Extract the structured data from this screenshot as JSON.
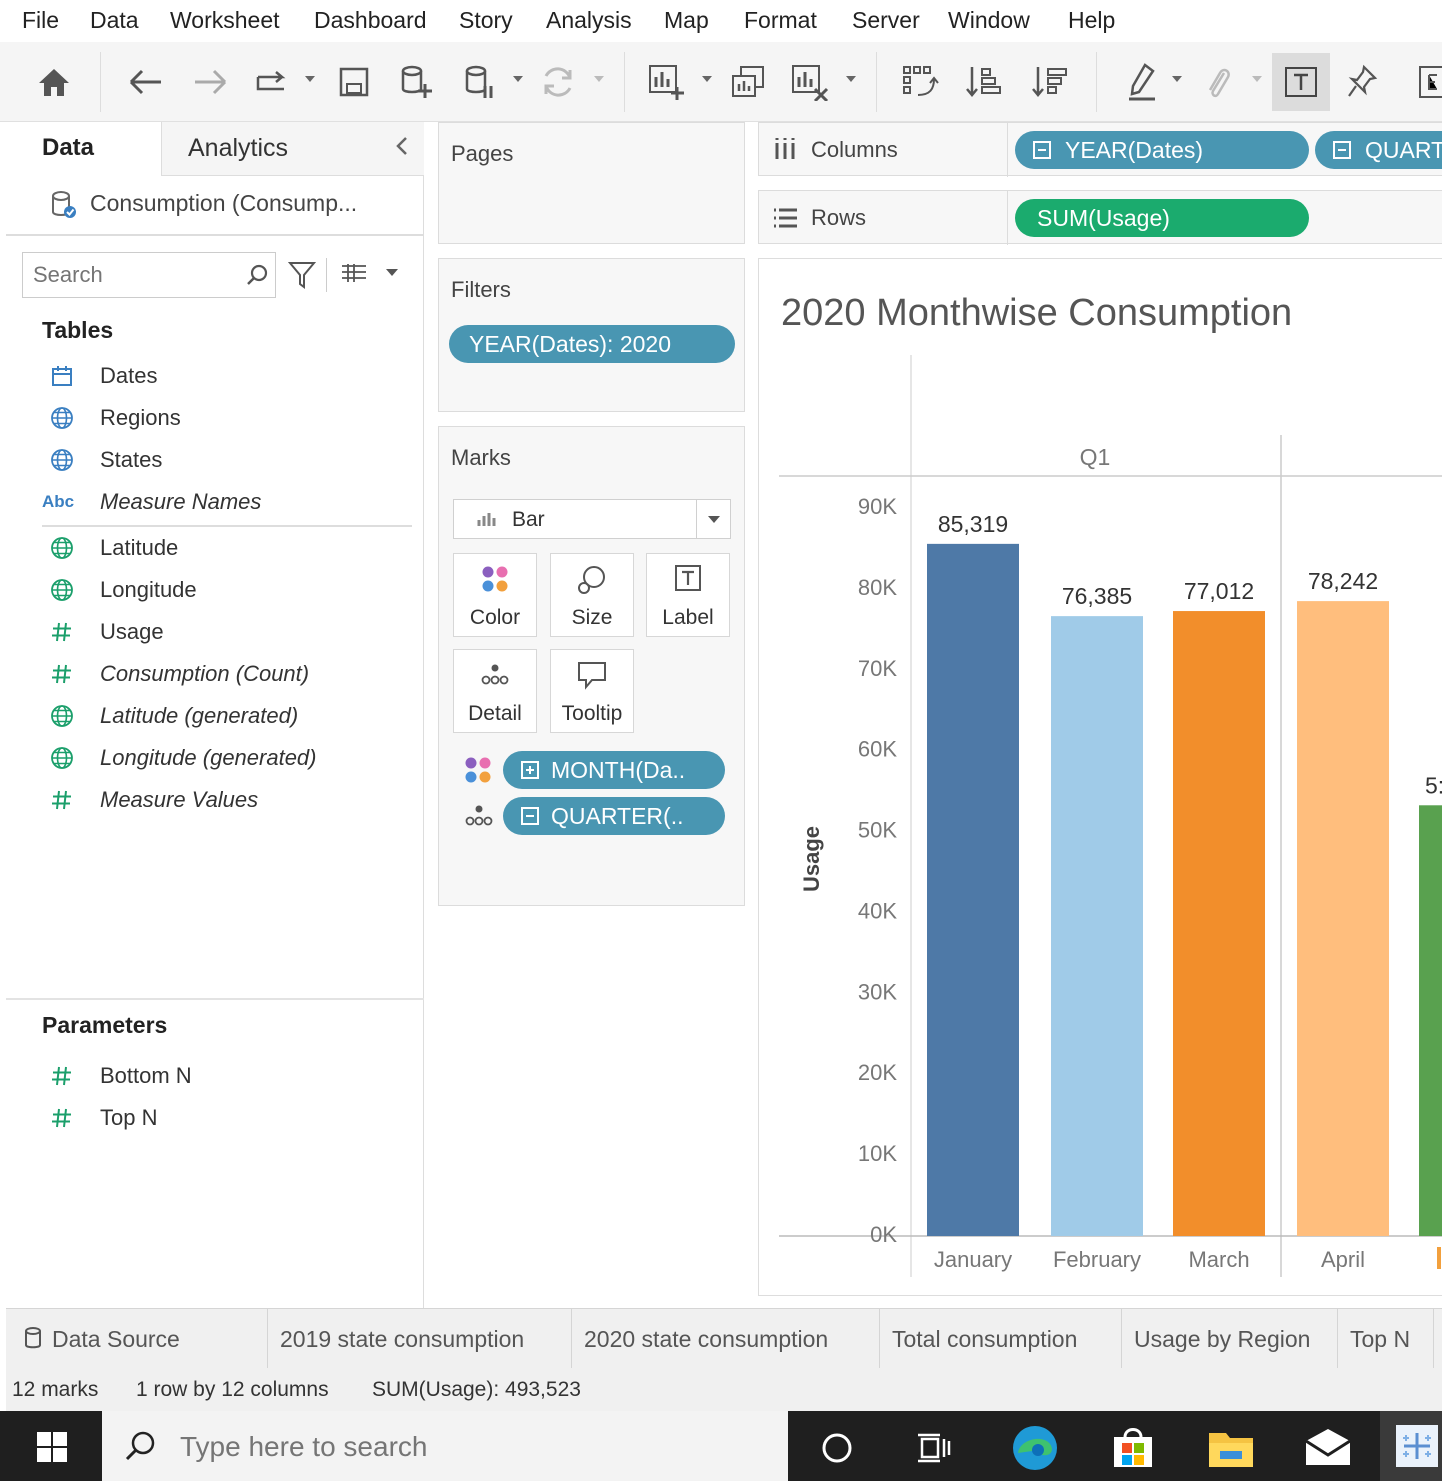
{
  "menu": [
    "File",
    "Data",
    "Worksheet",
    "Dashboard",
    "Story",
    "Analysis",
    "Map",
    "Format",
    "Server",
    "Window",
    "Help"
  ],
  "data_pane": {
    "tab_data": "Data",
    "tab_analytics": "Analytics",
    "datasource": "Consumption (Consump...",
    "search_placeholder": "Search",
    "tables_header": "Tables",
    "fields": [
      {
        "label": "Dates",
        "icon": "calendar-icon",
        "italic": false
      },
      {
        "label": "Regions",
        "icon": "globe-icon",
        "italic": false
      },
      {
        "label": "States",
        "icon": "globe-icon",
        "italic": false
      },
      {
        "label": "Measure Names",
        "icon": "abc-icon",
        "italic": true
      },
      {
        "label": "Latitude",
        "icon": "globe-icon",
        "italic": false
      },
      {
        "label": "Longitude",
        "icon": "globe-icon",
        "italic": false
      },
      {
        "label": "Usage",
        "icon": "hash-icon",
        "italic": false
      },
      {
        "label": "Consumption (Count)",
        "icon": "hash-icon",
        "italic": true
      },
      {
        "label": "Latitude (generated)",
        "icon": "globe-icon",
        "italic": true
      },
      {
        "label": "Longitude (generated)",
        "icon": "globe-icon",
        "italic": true
      },
      {
        "label": "Measure Values",
        "icon": "hash-icon",
        "italic": true
      }
    ],
    "abc_text": "Abc",
    "parameters_header": "Parameters",
    "parameters": [
      {
        "label": "Bottom N",
        "icon": "hash-icon"
      },
      {
        "label": "Top N",
        "icon": "hash-icon"
      }
    ]
  },
  "pages": {
    "title": "Pages"
  },
  "filters": {
    "title": "Filters",
    "pill": "YEAR(Dates): 2020"
  },
  "marks": {
    "title": "Marks",
    "type": "Bar",
    "buttons": [
      "Color",
      "Size",
      "Label",
      "Detail",
      "Tooltip"
    ],
    "pills": [
      "MONTH(Da..",
      "QUARTER(.."
    ]
  },
  "shelves": {
    "columns_label": "Columns",
    "rows_label": "Rows",
    "columns_pills": [
      "YEAR(Dates)",
      "QUART"
    ],
    "rows_pills": [
      "SUM(Usage)"
    ]
  },
  "chart_data": {
    "type": "bar",
    "title": "2020 Monthwise Consumption",
    "ylabel": "Usage",
    "header": "Q1",
    "categories": [
      "January",
      "February",
      "March",
      "April"
    ],
    "values": [
      85319,
      76385,
      77012,
      78242
    ],
    "value_labels": [
      "85,319",
      "76,385",
      "77,012",
      "78,242"
    ],
    "colors": [
      "#4e79a7",
      "#a0cbe8",
      "#f28e2b",
      "#ffbe7d"
    ],
    "yticks": [
      "90K",
      "80K",
      "70K",
      "60K",
      "50K",
      "40K",
      "30K",
      "20K",
      "10K",
      "0K"
    ],
    "ylim": [
      0,
      90000
    ],
    "partial_next_bar": {
      "value": 53000,
      "label": "5:",
      "color": "#59a14f"
    }
  },
  "sheet_tabs": [
    "Data Source",
    "2019 state consumption",
    "2020 state consumption",
    "Total consumption",
    "Usage by Region",
    "Top N"
  ],
  "status": {
    "marks": "12 marks",
    "dims": "1 row by 12 columns",
    "sum": "SUM(Usage): 493,523"
  },
  "taskbar": {
    "search_placeholder": "Type here to search"
  }
}
